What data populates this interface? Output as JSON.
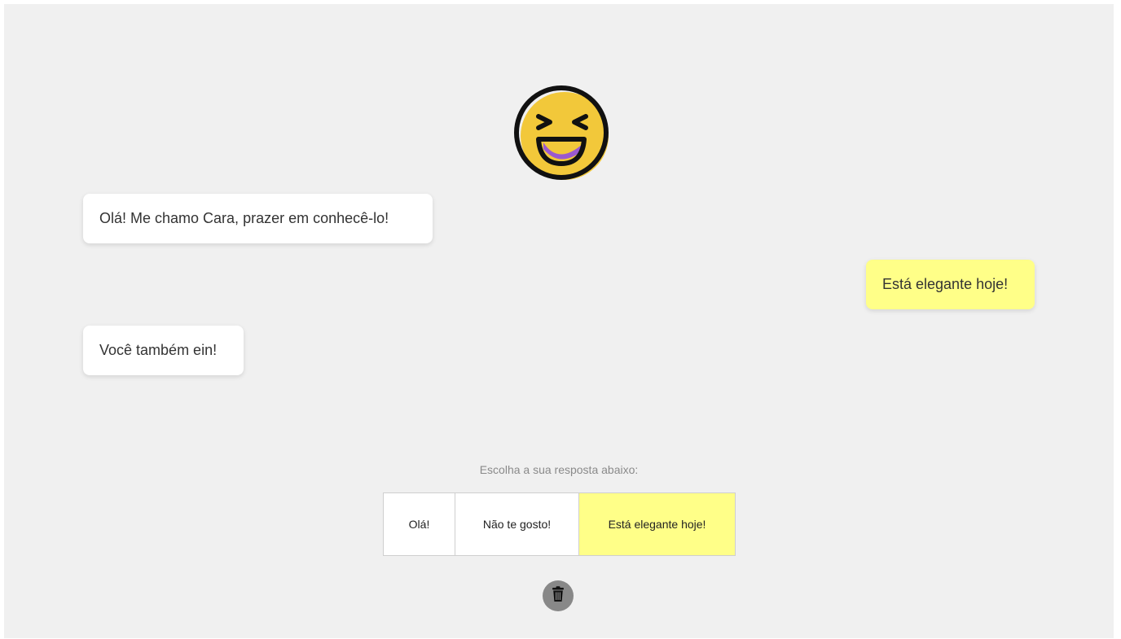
{
  "avatar": {
    "icon": "laughing-face-icon",
    "colors": {
      "face": "#f2c83a",
      "mouth": "#9b59d0",
      "outline": "#111111"
    }
  },
  "messages": [
    {
      "sender": "bot",
      "text": "Olá! Me chamo Cara, prazer em conhecê-lo!"
    },
    {
      "sender": "user",
      "text": "Está elegante hoje!"
    },
    {
      "sender": "bot",
      "text": "Você também ein!"
    }
  ],
  "prompt": "Escolha a sua resposta abaixo:",
  "options": [
    {
      "label": "Olá!",
      "selected": false
    },
    {
      "label": "Não te gosto!",
      "selected": false
    },
    {
      "label": "Está elegante hoje!",
      "selected": true
    }
  ],
  "trash": {
    "icon": "trash-icon"
  },
  "colors": {
    "background": "#f0f0f0",
    "user_bubble": "#ffff88",
    "bot_bubble": "#ffffff",
    "trash_button": "#888888"
  }
}
